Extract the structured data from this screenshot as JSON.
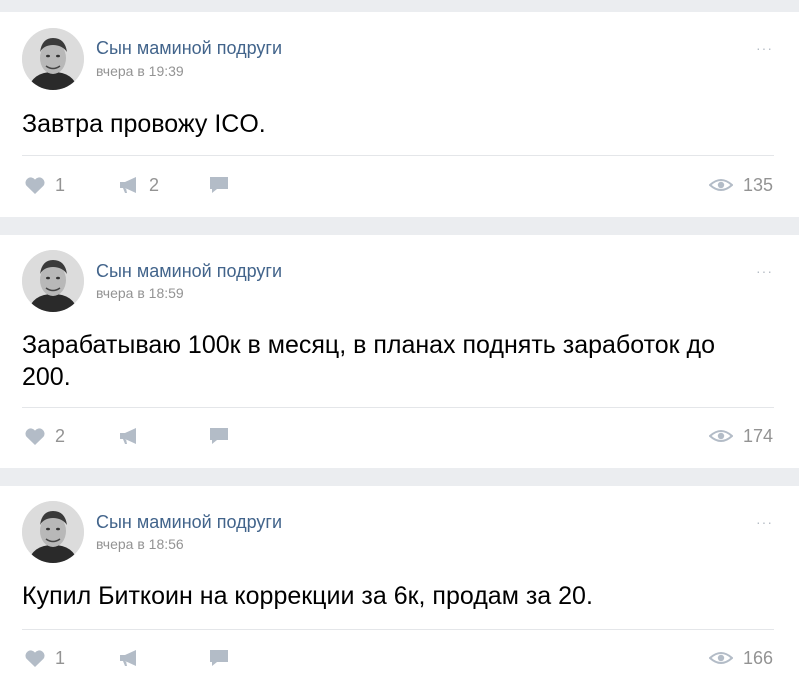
{
  "posts": [
    {
      "author": "Сын маминой подруги",
      "time": "вчера в 19:39",
      "text": "Завтра провожу ICO.",
      "likes": "1",
      "reposts": "2",
      "views": "135",
      "more": "···"
    },
    {
      "author": "Сын маминой подруги",
      "time": "вчера в 18:59",
      "text": "Зарабатываю 100к в месяц, в планах поднять заработок до 200.",
      "likes": "2",
      "reposts": "",
      "views": "174",
      "more": "···"
    },
    {
      "author": "Сын маминой подруги",
      "time": "вчера в 18:56",
      "text": "Купил Биткоин на коррекции за 6к, продам за 20.",
      "likes": "1",
      "reposts": "",
      "views": "166",
      "more": "···"
    }
  ],
  "icons": {
    "like": "heart-icon",
    "repost": "megaphone-icon",
    "comment": "comment-icon",
    "views": "eye-icon"
  },
  "colors": {
    "author": "#42648b",
    "meta": "#939393",
    "icon": "#b3bcc7",
    "background": "#ebedf0"
  }
}
